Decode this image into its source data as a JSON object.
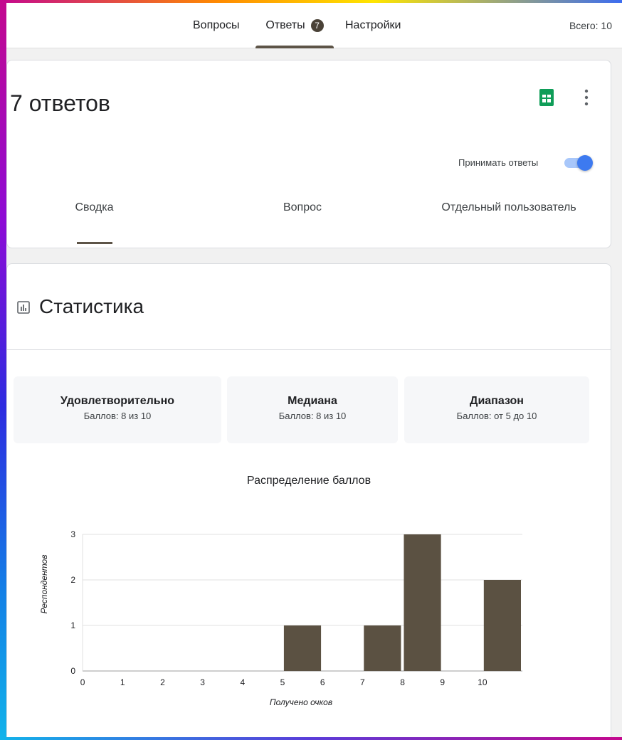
{
  "nav": {
    "tabs": [
      {
        "label": "Вопросы"
      },
      {
        "label": "Ответы",
        "badge": "7"
      },
      {
        "label": "Настройки"
      }
    ],
    "total": "Всего: 10"
  },
  "responses": {
    "title": "7 ответов",
    "accept_label": "Принимать ответы",
    "accepting": true,
    "subtabs": [
      "Сводка",
      "Вопрос",
      "Отдельный пользователь"
    ]
  },
  "stats": {
    "title": "Статистика",
    "boxes": [
      {
        "label": "Удовлетворительно",
        "value": "Баллов: 8 из 10"
      },
      {
        "label": "Медиана",
        "value": "Баллов: 8 из 10"
      },
      {
        "label": "Диапазон",
        "value": "Баллов: от 5 до 10"
      }
    ]
  },
  "colors": {
    "accent": "#5d5447",
    "bar": "#5b5142",
    "toggle": "#3d7af0",
    "sheets": "#0f9d58"
  },
  "chart_data": {
    "type": "bar",
    "title": "Распределение баллов",
    "xlabel": "Получено очков",
    "ylabel": "Респондентов",
    "categories": [
      "0",
      "1",
      "2",
      "3",
      "4",
      "5",
      "6",
      "7",
      "8",
      "9",
      "10"
    ],
    "values": [
      0,
      0,
      0,
      0,
      0,
      1,
      0,
      1,
      3,
      0,
      2
    ],
    "yticks": [
      "0",
      "1",
      "2",
      "3"
    ],
    "ylim": [
      0,
      3
    ],
    "grid": true
  }
}
